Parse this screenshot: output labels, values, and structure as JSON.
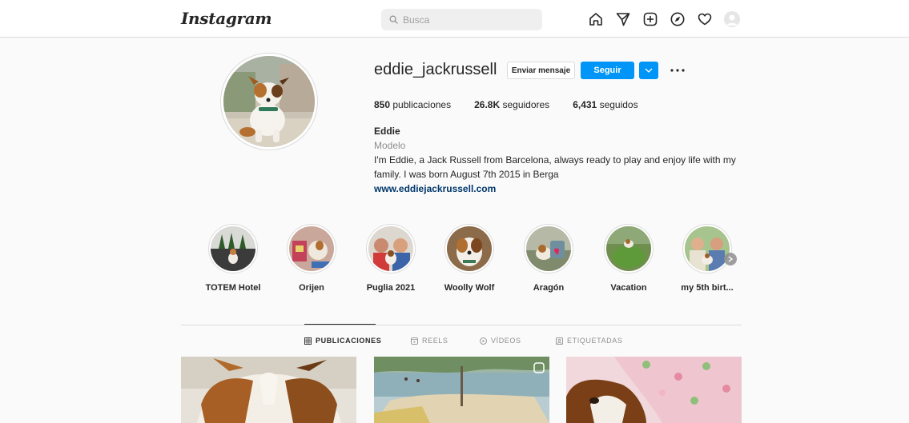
{
  "nav": {
    "logo": "Instagram",
    "search_placeholder": "Busca"
  },
  "profile": {
    "username": "eddie_jackrussell",
    "message_button": "Enviar mensaje",
    "follow_button": "Seguir",
    "stats": {
      "posts_count": "850",
      "posts_label": "publicaciones",
      "followers_count": "26.8K",
      "followers_label": "seguidores",
      "following_count": "6,431",
      "following_label": "seguidos"
    },
    "full_name": "Eddie",
    "category": "Modelo",
    "bio": "I'm Eddie, a Jack Russell from Barcelona, always ready to play and enjoy life with my family. I was born August 7th 2015 in Berga",
    "website": "www.eddiejackrussell.com"
  },
  "highlights": [
    {
      "label": "TOTEM Hotel"
    },
    {
      "label": "Orijen"
    },
    {
      "label": "Puglia 2021"
    },
    {
      "label": "Woolly Wolf"
    },
    {
      "label": "Aragón"
    },
    {
      "label": "Vacation"
    },
    {
      "label": "my 5th birt..."
    }
  ],
  "tabs": [
    {
      "label": "PUBLICACIONES",
      "icon": "grid-icon",
      "active": true
    },
    {
      "label": "REELS",
      "icon": "reels-icon",
      "active": false
    },
    {
      "label": "VÍDEOS",
      "icon": "video-icon",
      "active": false
    },
    {
      "label": "ETIQUETADAS",
      "icon": "tagged-icon",
      "active": false
    }
  ],
  "colors": {
    "accent": "#0095f6",
    "link": "#00376b",
    "muted": "#8e8e8e",
    "border": "#dbdbdb",
    "background": "#fafafa"
  }
}
